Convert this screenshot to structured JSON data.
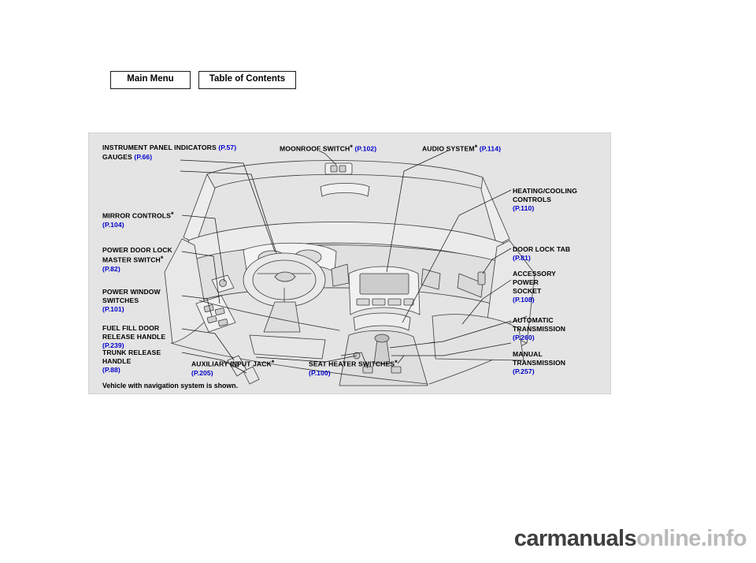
{
  "nav": {
    "main_menu": "Main Menu",
    "table_of_contents": "Table of Contents"
  },
  "colors": {
    "page_reference": "#0000cc",
    "panel_background": "#e4e4e4",
    "text": "#000000"
  },
  "callouts": {
    "instrument_panel": {
      "line1": "INSTRUMENT PANEL INDICATORS",
      "ref1": "(P.57)",
      "line2": "GAUGES",
      "ref2": "(P.66)"
    },
    "moonroof": {
      "label": "MOONROOF SWITCH",
      "asterisk": "*",
      "ref": "(P.102)"
    },
    "audio": {
      "label": "AUDIO SYSTEM",
      "asterisk": "*",
      "ref": "(P.114)"
    },
    "heating_cooling": {
      "line1": "HEATING/COOLING",
      "line2": "CONTROLS",
      "ref": "(P.110)"
    },
    "mirror_controls": {
      "label": "MIRROR CONTROLS",
      "asterisk": "*",
      "ref": "(P.104)"
    },
    "power_door_lock": {
      "line1": "POWER DOOR LOCK",
      "line2": "MASTER SWITCH",
      "asterisk": "*",
      "ref": "(P.82)"
    },
    "power_window": {
      "line1": "POWER WINDOW",
      "line2": "SWITCHES",
      "ref": "(P.101)"
    },
    "fuel_fill_door": {
      "line1": "FUEL FILL DOOR",
      "line2": "RELEASE HANDLE",
      "ref": "(P.239)"
    },
    "trunk_release": {
      "line1": "TRUNK RELEASE",
      "line2": "HANDLE",
      "ref": "(P.88)"
    },
    "door_lock_tab": {
      "label": "DOOR LOCK TAB",
      "ref": "(P.81)"
    },
    "accessory_power_socket": {
      "line1": "ACCESSORY",
      "line2": "POWER",
      "line3": "SOCKET",
      "ref": "(P.108)"
    },
    "automatic_transmission": {
      "line1": "AUTOMATIC",
      "line2": "TRANSMISSION",
      "ref": "(P.260)"
    },
    "manual_transmission": {
      "line1": "MANUAL",
      "line2": "TRANSMISSION",
      "ref": "(P.257)"
    },
    "auxiliary_input_jack": {
      "label": "AUXILIARY INPUT JACK",
      "asterisk": "*",
      "ref": "(P.205)"
    },
    "seat_heater_switches": {
      "label": "SEAT HEATER SWITCHES",
      "asterisk": "*",
      "ref": "(P.100)"
    }
  },
  "caption": "Vehicle with navigation system is shown.",
  "watermark": {
    "dark": "carmanuals",
    "light": "online.info"
  }
}
